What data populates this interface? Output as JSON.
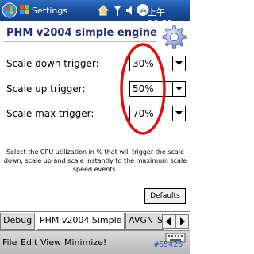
{
  "titlebar": {
    "title": "Settings",
    "clock": "上午 10:31",
    "icons": [
      "windows-start-icon",
      "home-icon",
      "connectivity-icon",
      "volume-icon",
      "ok-icon"
    ],
    "ok_label": "ok"
  },
  "header": {
    "title": "PHM v2004 simple engine",
    "icon": "gear-icon"
  },
  "settings": [
    {
      "label": "Scale down trigger:",
      "value": "30%"
    },
    {
      "label": "Scale up trigger:",
      "value": "50%"
    },
    {
      "label": "Scale max trigger:",
      "value": "70%"
    }
  ],
  "description": "Select the CPU utilization in % that will trigger the scale down, scale up and scale instantly to the maximum scale speed events.",
  "defaults_button": "Defaults",
  "tabs": [
    {
      "label": "Debug",
      "active": false
    },
    {
      "label": "PHM v2004 Simple",
      "active": true
    },
    {
      "label": "AVGN",
      "active": false
    },
    {
      "label": "S",
      "active": false
    }
  ],
  "menu": {
    "items": [
      "File",
      "Edit",
      "View",
      "Minimize!"
    ]
  },
  "watermark": "#65426",
  "colors": {
    "titlebar": "#1a4f9c",
    "heading": "#1c2a7a",
    "annotation_oval": "#e01010"
  }
}
